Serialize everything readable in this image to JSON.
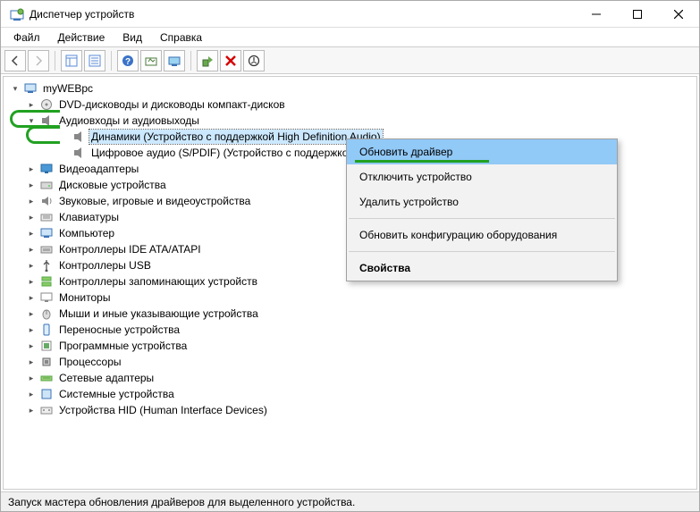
{
  "window": {
    "title": "Диспетчер устройств"
  },
  "menus": {
    "file": "Файл",
    "action": "Действие",
    "view": "Вид",
    "help": "Справка"
  },
  "tree": {
    "root": "myWEBpc",
    "categories": [
      {
        "icon": "disc",
        "label": "DVD-дисководы и дисководы компакт-дисков",
        "expanded": false
      },
      {
        "icon": "audio",
        "label": "Аудиовходы и аудиовыходы",
        "expanded": true,
        "children": [
          {
            "icon": "speaker",
            "label": "Динамики (Устройство с поддержкой High Definition Audio)",
            "selected": true
          },
          {
            "icon": "speaker",
            "label": "Цифровое аудио (S/PDIF) (Устройство с поддержкой"
          }
        ]
      },
      {
        "icon": "display",
        "label": "Видеоадаптеры",
        "expanded": false
      },
      {
        "icon": "drive",
        "label": "Дисковые устройства",
        "expanded": false
      },
      {
        "icon": "sound",
        "label": "Звуковые, игровые и видеоустройства",
        "expanded": false
      },
      {
        "icon": "keyboard",
        "label": "Клавиатуры",
        "expanded": false
      },
      {
        "icon": "pc",
        "label": "Компьютер",
        "expanded": false
      },
      {
        "icon": "ide",
        "label": "Контроллеры IDE ATA/ATAPI",
        "expanded": false
      },
      {
        "icon": "usb",
        "label": "Контроллеры USB",
        "expanded": false
      },
      {
        "icon": "storage",
        "label": "Контроллеры запоминающих устройств",
        "expanded": false
      },
      {
        "icon": "monitor",
        "label": "Мониторы",
        "expanded": false
      },
      {
        "icon": "mouse",
        "label": "Мыши и иные указывающие устройства",
        "expanded": false
      },
      {
        "icon": "portable",
        "label": "Переносные устройства",
        "expanded": false
      },
      {
        "icon": "software",
        "label": "Программные устройства",
        "expanded": false
      },
      {
        "icon": "cpu",
        "label": "Процессоры",
        "expanded": false
      },
      {
        "icon": "network",
        "label": "Сетевые адаптеры",
        "expanded": false
      },
      {
        "icon": "system",
        "label": "Системные устройства",
        "expanded": false
      },
      {
        "icon": "hid",
        "label": "Устройства HID (Human Interface Devices)",
        "expanded": false
      }
    ]
  },
  "context_menu": {
    "update_driver": "Обновить драйвер",
    "disable_device": "Отключить устройство",
    "uninstall_device": "Удалить устройство",
    "scan_hardware": "Обновить конфигурацию оборудования",
    "properties": "Свойства"
  },
  "statusbar": {
    "text": "Запуск мастера обновления драйверов для выделенного устройства."
  }
}
